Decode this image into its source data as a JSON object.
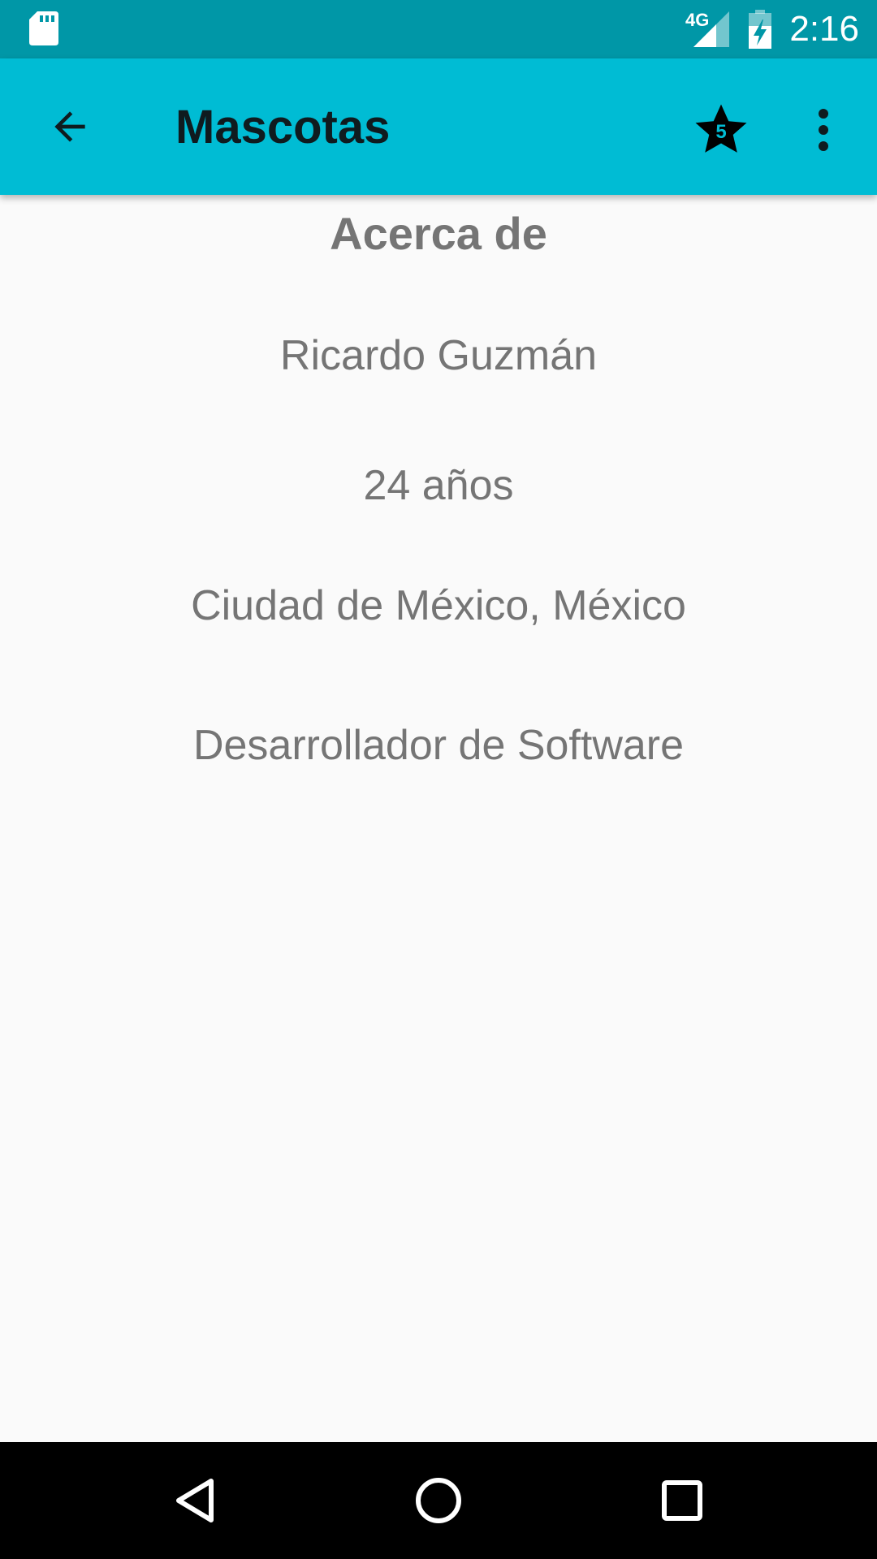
{
  "status_bar": {
    "network": "4G",
    "time": "2:16"
  },
  "app_bar": {
    "title": "Mascotas",
    "star_count": "5"
  },
  "content": {
    "heading": "Acerca de",
    "name": "Ricardo Guzmán",
    "age": "24 años",
    "location": "Ciudad de México, México",
    "occupation": "Desarrollador de Software"
  },
  "colors": {
    "status_bar": "#0097A7",
    "app_bar": "#00BCD4",
    "background": "#FAFAFA",
    "text_secondary": "#757575",
    "nav_bar": "#000000"
  }
}
